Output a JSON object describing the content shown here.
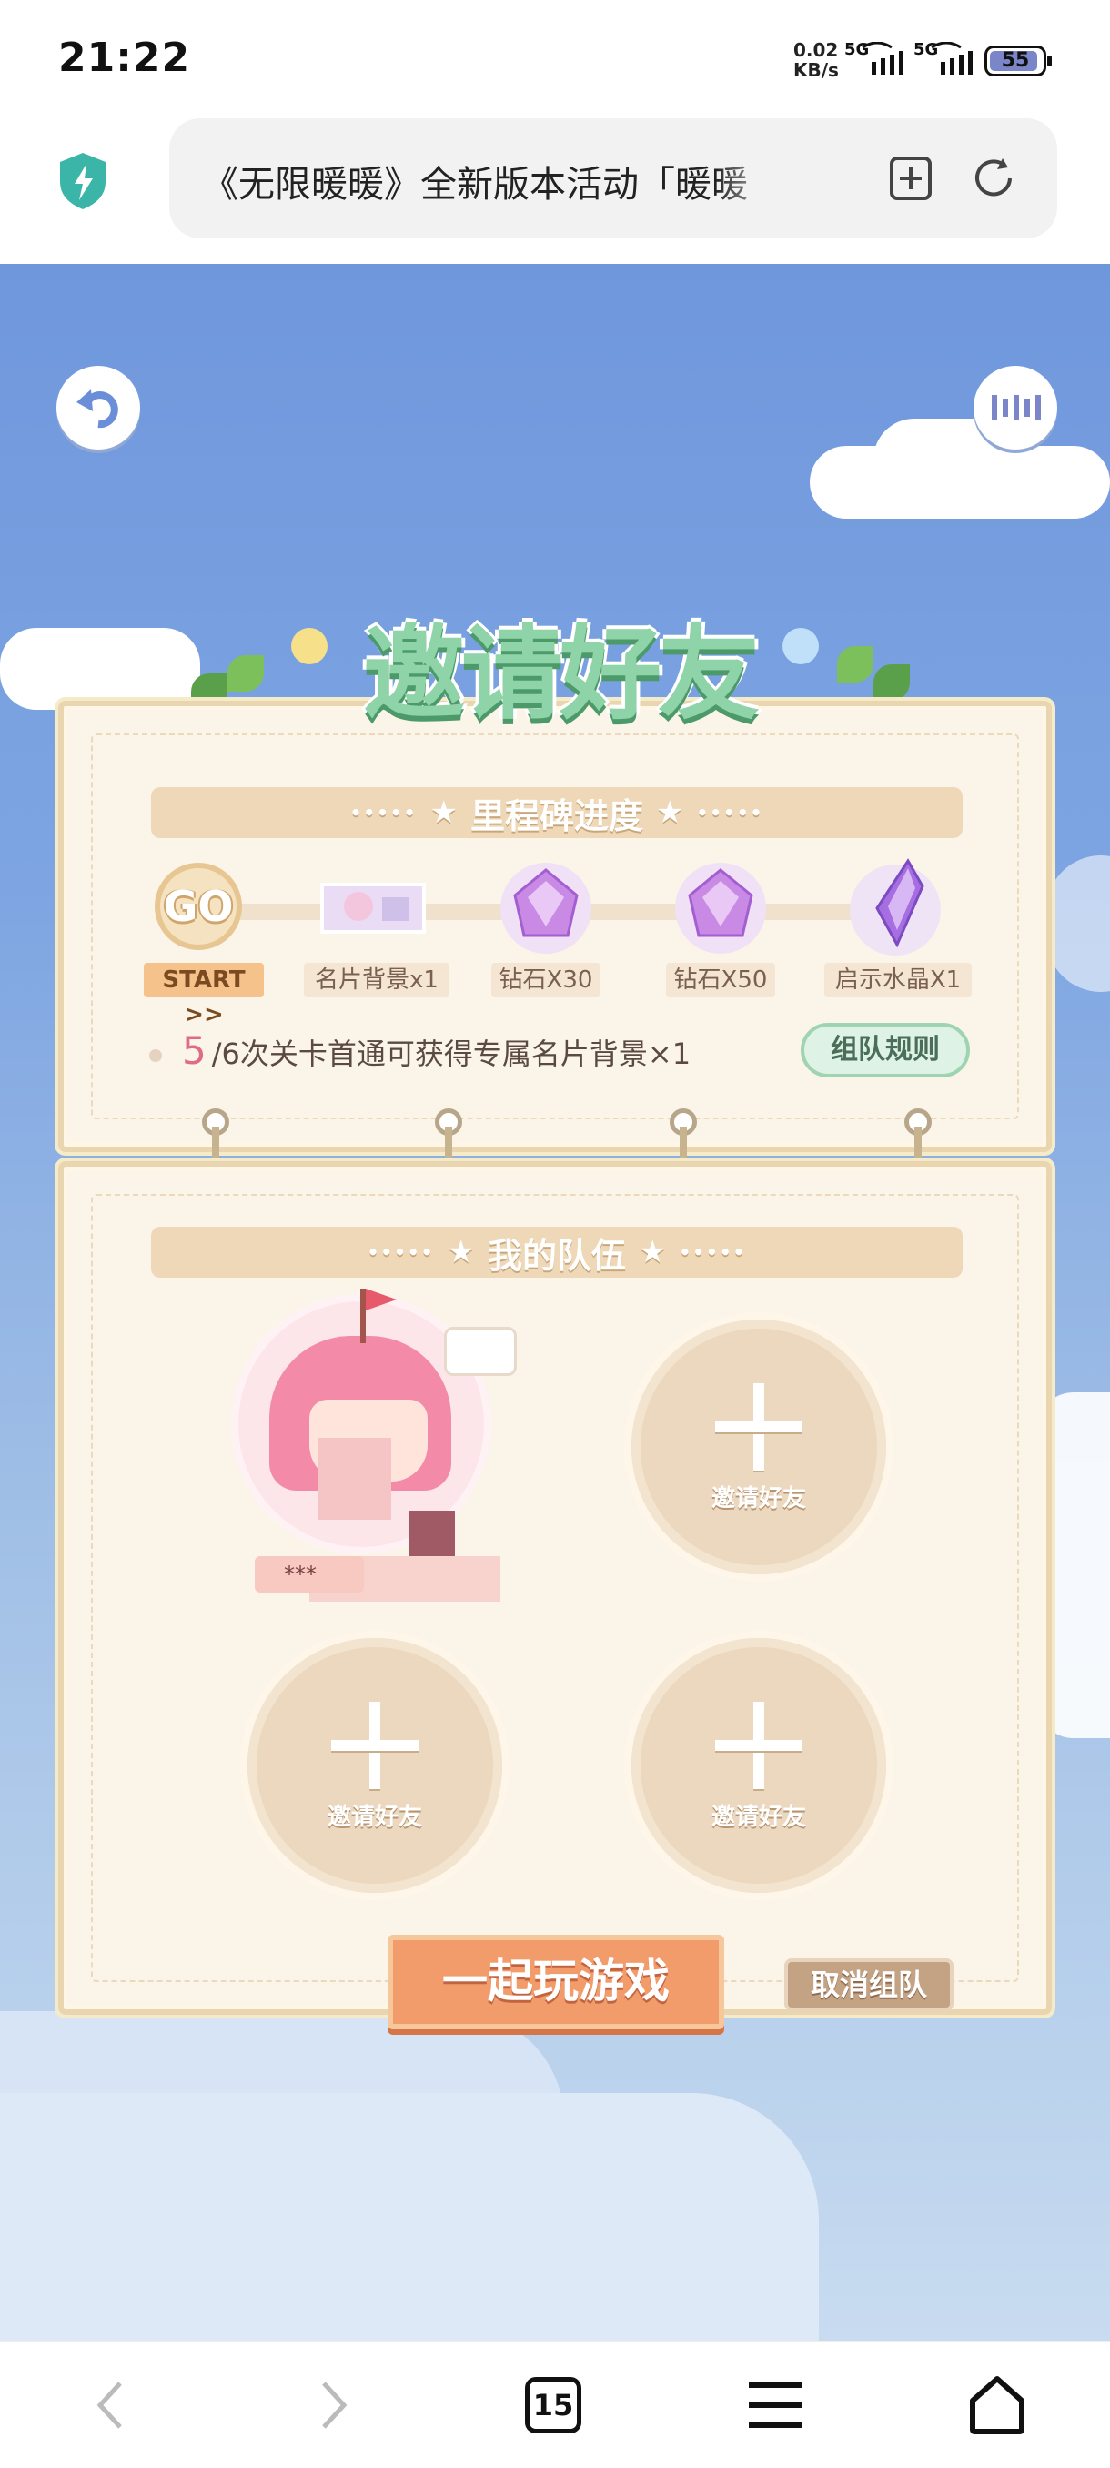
{
  "status_bar": {
    "time": "21:22",
    "net_speed_value": "0.02",
    "net_speed_unit": "KB/s",
    "signal1_label": "5G",
    "signal2_label": "5G",
    "battery": "55"
  },
  "browser": {
    "url_title": "《无限暖暖》全新版本活动「暖暖",
    "icons": [
      "shield-icon",
      "add-bookmark-icon",
      "reload-icon"
    ]
  },
  "game": {
    "title": "邀请好友",
    "milestone": {
      "banner": "里程碑进度",
      "go_badge": "GO",
      "start_label": "START >>",
      "rewards": [
        {
          "label": "名片背景x1",
          "icon": "card-background-icon"
        },
        {
          "label": "钻石X30",
          "icon": "diamond-icon"
        },
        {
          "label": "钻石X50",
          "icon": "diamond-icon"
        },
        {
          "label": "启示水晶X1",
          "icon": "crystal-icon"
        }
      ],
      "progress_current": "5",
      "progress_text": "/6次关卡首通可获得专属名片背景×1",
      "rules_button": "组队规则"
    },
    "team": {
      "banner": "我的队伍",
      "member_name": "***",
      "invite_label": "邀请好友"
    },
    "play_button": "一起玩游戏",
    "cancel_button": "取消组队",
    "colors": {
      "sky": "#6f97dc",
      "panel": "#fbf4e8",
      "title_green": "#8fd3a8",
      "play_orange": "#f29c6c",
      "progress_pink": "#e06a8a"
    }
  },
  "nav": {
    "tab_count": "15",
    "icons": [
      "back-icon",
      "forward-icon",
      "tabs-icon",
      "menu-icon",
      "home-icon"
    ]
  }
}
